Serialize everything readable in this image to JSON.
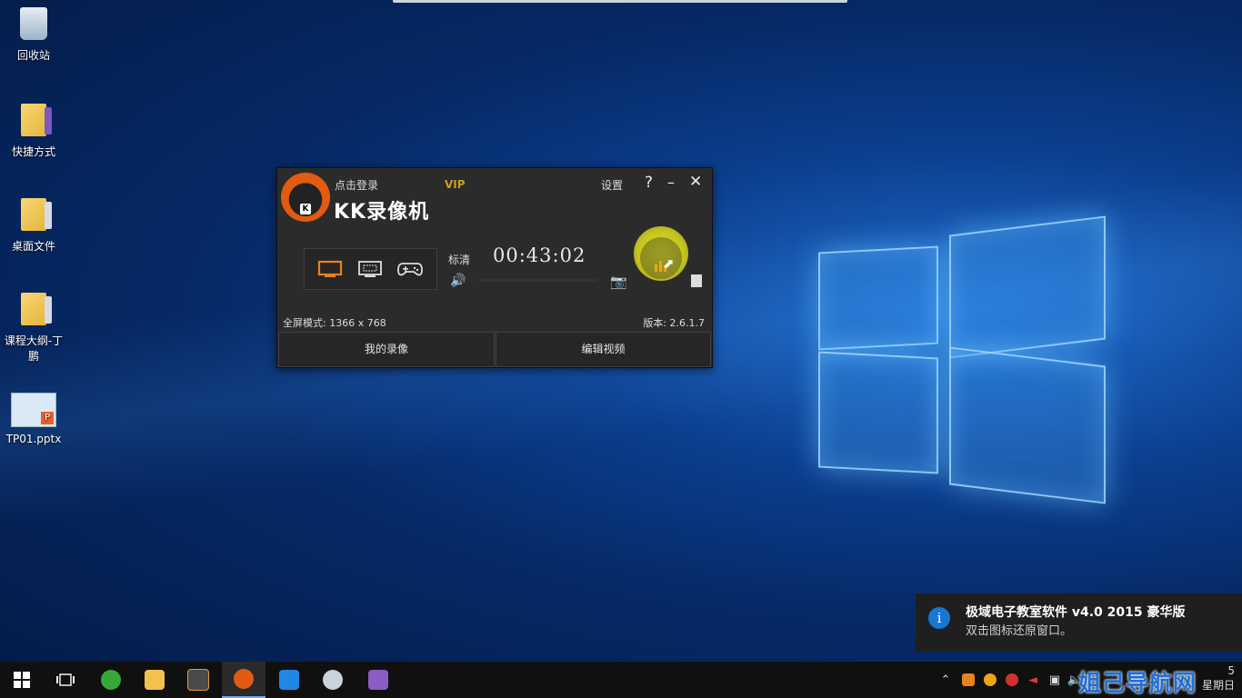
{
  "desktop": {
    "icons": [
      {
        "label": "回收站"
      },
      {
        "label": "快捷方式"
      },
      {
        "label": "桌面文件"
      },
      {
        "label": "课程大纲-丁\n鹏"
      },
      {
        "label": "TP01.pptx"
      }
    ]
  },
  "kk_recorder": {
    "login_text": "点击登录",
    "vip_text": "VIP",
    "title": "KK录像机",
    "settings_label": "设置",
    "help_label": "?",
    "quality_label": "标清",
    "timer": "00:43:02",
    "mode_text": "全屏模式: 1366 x 768",
    "version_text": "版本: 2.6.1.7",
    "my_recordings_label": "我的录像",
    "edit_video_label": "编辑视频"
  },
  "notification": {
    "title": "极域电子教室软件 v4.0 2015 豪华版",
    "message": "双击图标还原窗口。"
  },
  "taskbar": {
    "tray_right_text": "姐己导航网",
    "clock_line1": "5",
    "clock_line2": "星期日"
  }
}
